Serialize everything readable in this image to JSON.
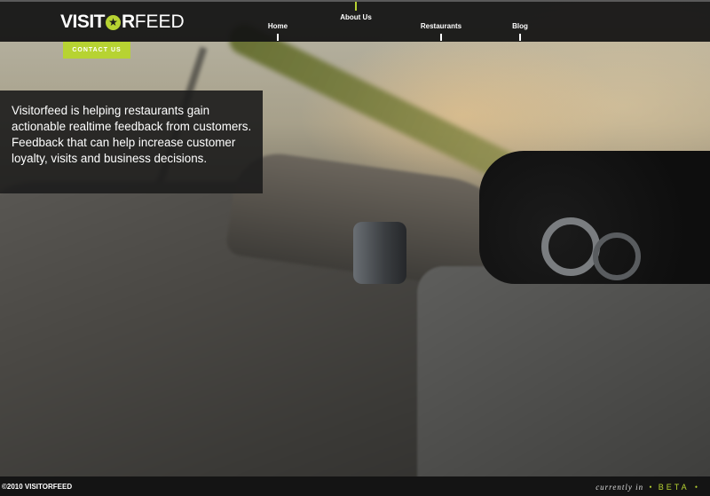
{
  "brand": {
    "name_bold": "VISIT",
    "name_middle": "R",
    "name_light": "FEED",
    "accent_color": "#b7d332"
  },
  "nav": {
    "items": [
      {
        "label": "Home"
      },
      {
        "label": "About Us",
        "active": true
      },
      {
        "label": "Restaurants"
      },
      {
        "label": "Blog"
      }
    ]
  },
  "contact": {
    "label": "CONTACT US"
  },
  "intro": {
    "text": "Visitorfeed is helping restaurants gain actionable realtime feedback from customers. Feedback that can help increase customer loyalty, visits and business decisions."
  },
  "footer": {
    "copyright": "©2010 VISITORFEED",
    "status_prefix": "currently in",
    "status_word": "BETA"
  }
}
